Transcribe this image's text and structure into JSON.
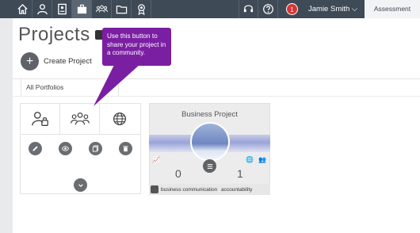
{
  "topbar": {
    "nav": [
      {
        "name": "home-icon"
      },
      {
        "name": "user-icon"
      },
      {
        "name": "document-icon"
      },
      {
        "name": "briefcase-icon"
      },
      {
        "name": "community-icon"
      },
      {
        "name": "folder-icon"
      },
      {
        "name": "award-icon"
      }
    ],
    "notification_count": "1",
    "user_name": "Jamie Smith",
    "assessment_label": "Assessment"
  },
  "page": {
    "title": "Projects",
    "create_label": "Create Project",
    "tab_label": "All Portfolios"
  },
  "tooltip": {
    "text": "Use this button to share your project in a community."
  },
  "project_card": {
    "title": "Business Project",
    "stat_left": "0",
    "stat_right": "1",
    "tags": [
      "business communication",
      "accountability"
    ]
  },
  "colors": {
    "topbar": "#3e4a56",
    "tooltip": "#7b1fa2",
    "button": "#6a6e72"
  }
}
